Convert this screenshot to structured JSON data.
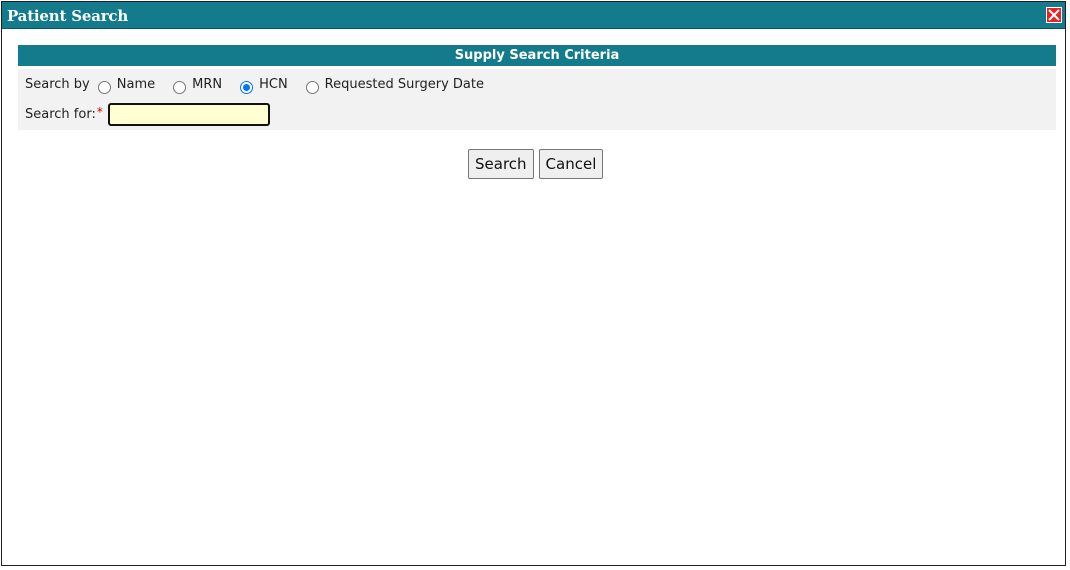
{
  "dialog": {
    "title": "Patient Search",
    "close_icon": "close-icon"
  },
  "panel": {
    "header": "Supply Search Criteria",
    "search_by_label": "Search by",
    "options": [
      {
        "label": "Name",
        "selected": false
      },
      {
        "label": "MRN",
        "selected": false
      },
      {
        "label": "HCN",
        "selected": true
      },
      {
        "label": "Requested Surgery Date",
        "selected": false
      }
    ],
    "search_for_label": "Search for:",
    "required_marker": "*",
    "search_value": "",
    "input_bg": "#ffffd2"
  },
  "actions": {
    "search_label": "Search",
    "cancel_label": "Cancel"
  },
  "colors": {
    "header_teal": "#137b8c",
    "close_red": "#e62424",
    "radio_selected": "#0075ff"
  }
}
